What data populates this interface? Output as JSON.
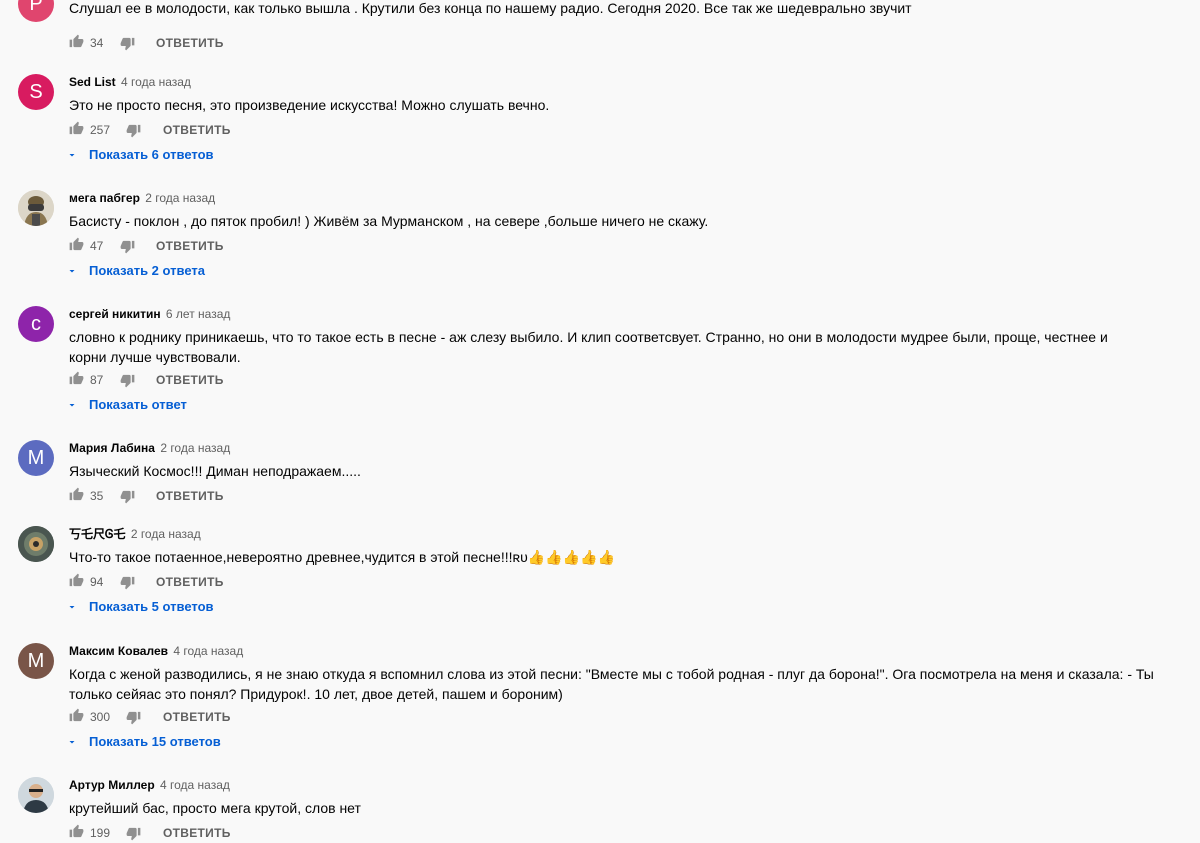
{
  "comments": [
    {
      "avatar_letter": "P",
      "avatar_color": "#e0456e",
      "author": "",
      "time": "",
      "text": "Слушал ее в молодости, как только вышла . Крутили без конца по нашему радио. Сегодня 2020. Все так же шедеврально звучит",
      "likes": "34",
      "reply_label": "ОТВЕТИТЬ",
      "replies_label": ""
    },
    {
      "avatar_letter": "S",
      "avatar_color": "#d81b60",
      "author": "Sed List",
      "time": "4 года назад",
      "text": "Это не просто песня, это произведение искусства! Можно слушать вечно.",
      "likes": "257",
      "reply_label": "ОТВЕТИТЬ",
      "replies_label": "Показать 6 ответов"
    },
    {
      "avatar_letter": "",
      "avatar_color": "#d7d2c4",
      "author": "мега пабгер",
      "time": "2 года назад",
      "text": "Басисту - поклон , до пяток пробил! ) Живём за Мурманском , на севере ,больше ничего не скажу.",
      "likes": "47",
      "reply_label": "ОТВЕТИТЬ",
      "replies_label": "Показать 2 ответа"
    },
    {
      "avatar_letter": "с",
      "avatar_color": "#8e24aa",
      "author": "сергей никитин",
      "time": "6 лет назад",
      "text": "словно к роднику приникаешь, что то такое есть в  песне  - аж слезу выбило. И клип соответсвует. Странно, но они в молодости мудрее были, проще, честнее и корни лучше чувствовали.",
      "likes": "87",
      "reply_label": "ОТВЕТИТЬ",
      "replies_label": "Показать ответ"
    },
    {
      "avatar_letter": "M",
      "avatar_color": "#5c6bc0",
      "author": "Мария Лабина",
      "time": "2 года назад",
      "text": "Языческий Космос!!! Диман неподражаем.....",
      "likes": "35",
      "reply_label": "ОТВЕТИТЬ",
      "replies_label": ""
    },
    {
      "avatar_letter": "",
      "avatar_color": "#3f4a45",
      "author": "丂乇尺Ꮆ乇",
      "time": "2 года назад",
      "text": "Что-то такое потаенное,невероятно древнее,чудится в этой песне!!!ʀᴜ👍👍👍👍👍",
      "likes": "94",
      "reply_label": "ОТВЕТИТЬ",
      "replies_label": "Показать 5 ответов"
    },
    {
      "avatar_letter": "M",
      "avatar_color": "#795548",
      "author": "Максим Ковалев",
      "time": "4 года назад",
      "text": "Когда с женой разводились, я не знаю откуда я вспомнил слова из этой песни: \"Вместе мы с тобой родная - плуг да борона!\". Ога посмотрела на меня и сказала: - Ты только сейяас это понял? Придурок!. 10 лет, двое детей, пашем и бороним)",
      "likes": "300",
      "reply_label": "ОТВЕТИТЬ",
      "replies_label": "Показать 15 ответов"
    },
    {
      "avatar_letter": "",
      "avatar_color": "#c9d3dc",
      "author": "Артур Миллер",
      "time": "4 года назад",
      "text": "крутейший бас, просто мега крутой, слов нет",
      "likes": "199",
      "reply_label": "ОТВЕТИТЬ",
      "replies_label": ""
    }
  ]
}
